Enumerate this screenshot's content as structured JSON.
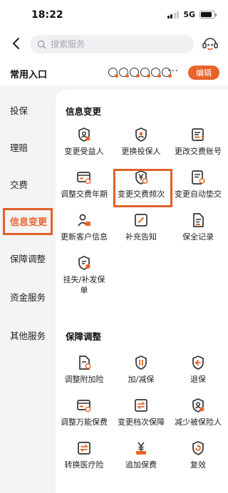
{
  "status_bar": {
    "time": "18:22",
    "network": "5G",
    "signal_bars": 4,
    "signal_active": 2,
    "battery_level": 0.85
  },
  "search": {
    "placeholder": "搜索服务"
  },
  "shortcuts": {
    "title": "常用入口",
    "icon_count": 6,
    "more": "···",
    "edit_label": "编辑"
  },
  "sidebar": {
    "items": [
      {
        "label": "投保"
      },
      {
        "label": "理赔"
      },
      {
        "label": "交费"
      },
      {
        "label": "信息变更",
        "active": true
      },
      {
        "label": "保障调整"
      },
      {
        "label": "资金服务"
      },
      {
        "label": "其他服务"
      }
    ]
  },
  "sections": [
    {
      "title": "信息变更",
      "items": [
        {
          "label": "变更受益人",
          "icon": "shield-person-icon"
        },
        {
          "label": "更换投保人",
          "icon": "shield-person-icon"
        },
        {
          "label": "更改交费账号",
          "icon": "card-edit-icon"
        },
        {
          "label": "调整交费年期",
          "icon": "card-cycle-icon"
        },
        {
          "label": "变更交费频次",
          "icon": "yen-cycle-icon"
        },
        {
          "label": "变更自动垫交",
          "icon": "doc-cycle-icon"
        },
        {
          "label": "更新客户信息",
          "icon": "person-card-icon"
        },
        {
          "label": "补充告知",
          "icon": "pencil-box-icon"
        },
        {
          "label": "保全记录",
          "icon": "document-icon"
        },
        {
          "label": "挂失/补发保单",
          "icon": "doc-lock-icon"
        }
      ]
    },
    {
      "title": "保障调整",
      "items": [
        {
          "label": "调整附加险",
          "icon": "doc-cycle-icon"
        },
        {
          "label": "加/减保",
          "icon": "shield-plus-icon"
        },
        {
          "label": "退保",
          "icon": "shield-return-icon"
        },
        {
          "label": "调整万能保费",
          "icon": "card-cycle-icon"
        },
        {
          "label": "变更档次保障",
          "icon": "swap-doc-icon"
        },
        {
          "label": "减少被保险人",
          "icon": "shield-person-icon"
        },
        {
          "label": "转换医疗险",
          "icon": "swap-doc-icon"
        },
        {
          "label": "追加保费",
          "icon": "yen-plus-icon"
        },
        {
          "label": "复效",
          "icon": "shield-cycle-icon"
        }
      ]
    }
  ],
  "colors": {
    "accent": "#e8642a",
    "icon_stroke": "#333333",
    "highlight": "#e0622a"
  }
}
